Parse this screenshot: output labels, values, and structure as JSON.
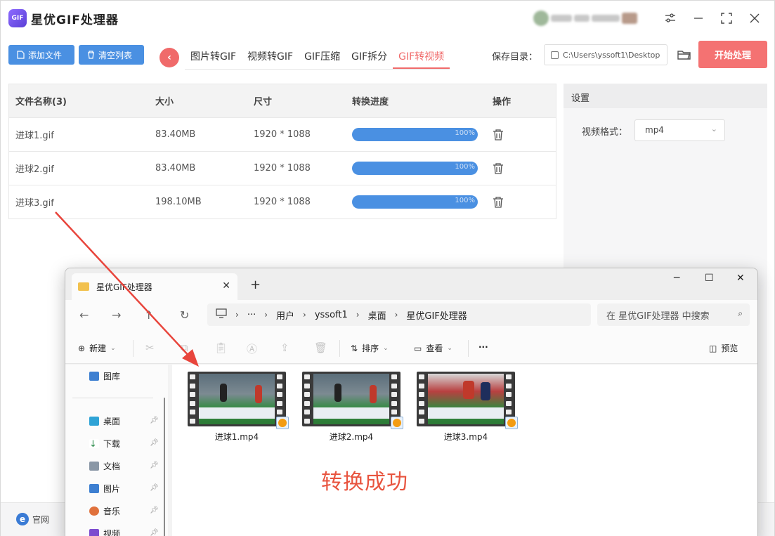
{
  "app": {
    "logo_text": "GIF",
    "title": "星优GIF处理器",
    "add_file": "添加文件",
    "clear_list": "清空列表",
    "tabs": [
      "图片转GIF",
      "视频转GIF",
      "GIF压缩",
      "GIF拆分",
      "GIF转视频"
    ],
    "active_tab": "GIF转视频",
    "save_dir_label": "保存目录：",
    "save_dir_value": "C:\\Users\\yssoft1\\Desktop",
    "start_button": "开始处理",
    "table_headers": {
      "name": "文件名称(3)",
      "size": "大小",
      "dimension": "尺寸",
      "progress": "转换进度",
      "action": "操作"
    },
    "files": [
      {
        "name": "进球1.gif",
        "size": "83.40MB",
        "dimension": "1920 * 1088",
        "progress": "100%",
        "progress_value": 100
      },
      {
        "name": "进球2.gif",
        "size": "83.40MB",
        "dimension": "1920 * 1088",
        "progress": "100%",
        "progress_value": 100
      },
      {
        "name": "进球3.gif",
        "size": "198.10MB",
        "dimension": "1920 * 1088",
        "progress": "100%",
        "progress_value": 100
      }
    ],
    "settings_title": "设置",
    "video_format_label": "视频格式：",
    "video_format_value": "mp4",
    "footer_link": "官网",
    "accent_color": "#f06a6a",
    "progress_color": "#4a90e2"
  },
  "explorer": {
    "tab_title": "星优GIF处理器",
    "breadcrumb": [
      "用户",
      "yssoft1",
      "桌面",
      "星优GIF处理器"
    ],
    "search_placeholder": "在 星优GIF处理器 中搜索",
    "cmd_new": "新建",
    "cmd_sort": "排序",
    "cmd_view": "查看",
    "cmd_more": "···",
    "cmd_preview": "预览",
    "nav_items": [
      {
        "label": "图库",
        "icon": "gallery-icon",
        "pinned": false
      },
      {
        "label": "桌面",
        "icon": "desktop-icon",
        "pinned": true
      },
      {
        "label": "下载",
        "icon": "download-icon",
        "pinned": true
      },
      {
        "label": "文档",
        "icon": "document-icon",
        "pinned": true
      },
      {
        "label": "图片",
        "icon": "pictures-icon",
        "pinned": true
      },
      {
        "label": "音乐",
        "icon": "music-icon",
        "pinned": true
      },
      {
        "label": "视频",
        "icon": "video-icon",
        "pinned": true
      }
    ],
    "files": [
      {
        "name": "进球1.mp4"
      },
      {
        "name": "进球2.mp4"
      },
      {
        "name": "进球3.mp4"
      }
    ]
  },
  "annotation": {
    "text": "转换成功",
    "color": "#e8543f"
  }
}
